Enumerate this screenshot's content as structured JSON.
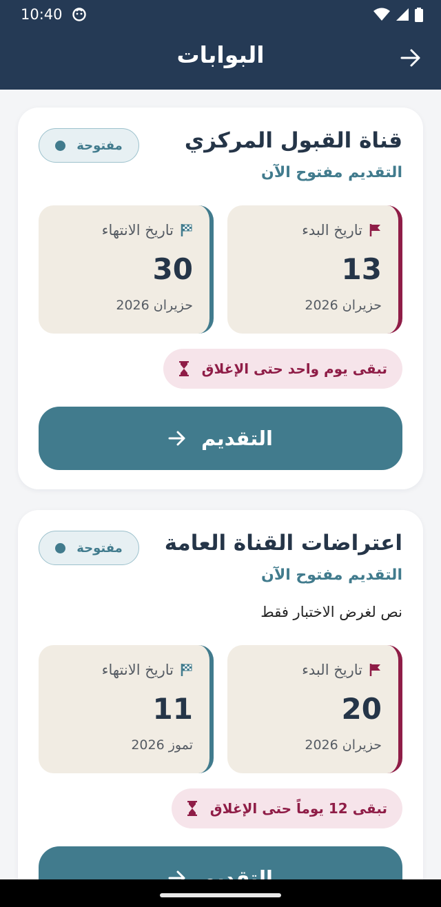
{
  "status_bar": {
    "time": "10:40"
  },
  "app_bar": {
    "title": "البوابات"
  },
  "cards": [
    {
      "title": "قناة القبول المركزي",
      "status": "مفتوحة",
      "subtitle": "التقديم مفتوح الآن",
      "description": "",
      "start": {
        "label": "تاريخ البدء",
        "day": "13",
        "month": "حزيران 2026"
      },
      "end": {
        "label": "تاريخ الانتهاء",
        "day": "30",
        "month": "حزيران 2026"
      },
      "remaining": "تبقى يوم واحد حتى الإغلاق",
      "apply": "التقديم"
    },
    {
      "title": "اعتراضات القناة العامة",
      "status": "مفتوحة",
      "subtitle": "التقديم مفتوح الآن",
      "description": "نص لغرض الاختبار فقط",
      "start": {
        "label": "تاريخ البدء",
        "day": "20",
        "month": "حزيران 2026"
      },
      "end": {
        "label": "تاريخ الانتهاء",
        "day": "11",
        "month": "تموز 2026"
      },
      "remaining": "تبقى 12 يوماً حتى الإغلاق",
      "apply": "التقديم"
    }
  ],
  "colors": {
    "header": "#253a55",
    "accent": "#417b8d",
    "danger": "#8f1d47",
    "date_bg": "#f1ece3"
  },
  "icons": [
    "arrow-right-icon",
    "flag-icon",
    "checkered-flag-icon",
    "hourglass-icon",
    "arrow-right-icon"
  ]
}
